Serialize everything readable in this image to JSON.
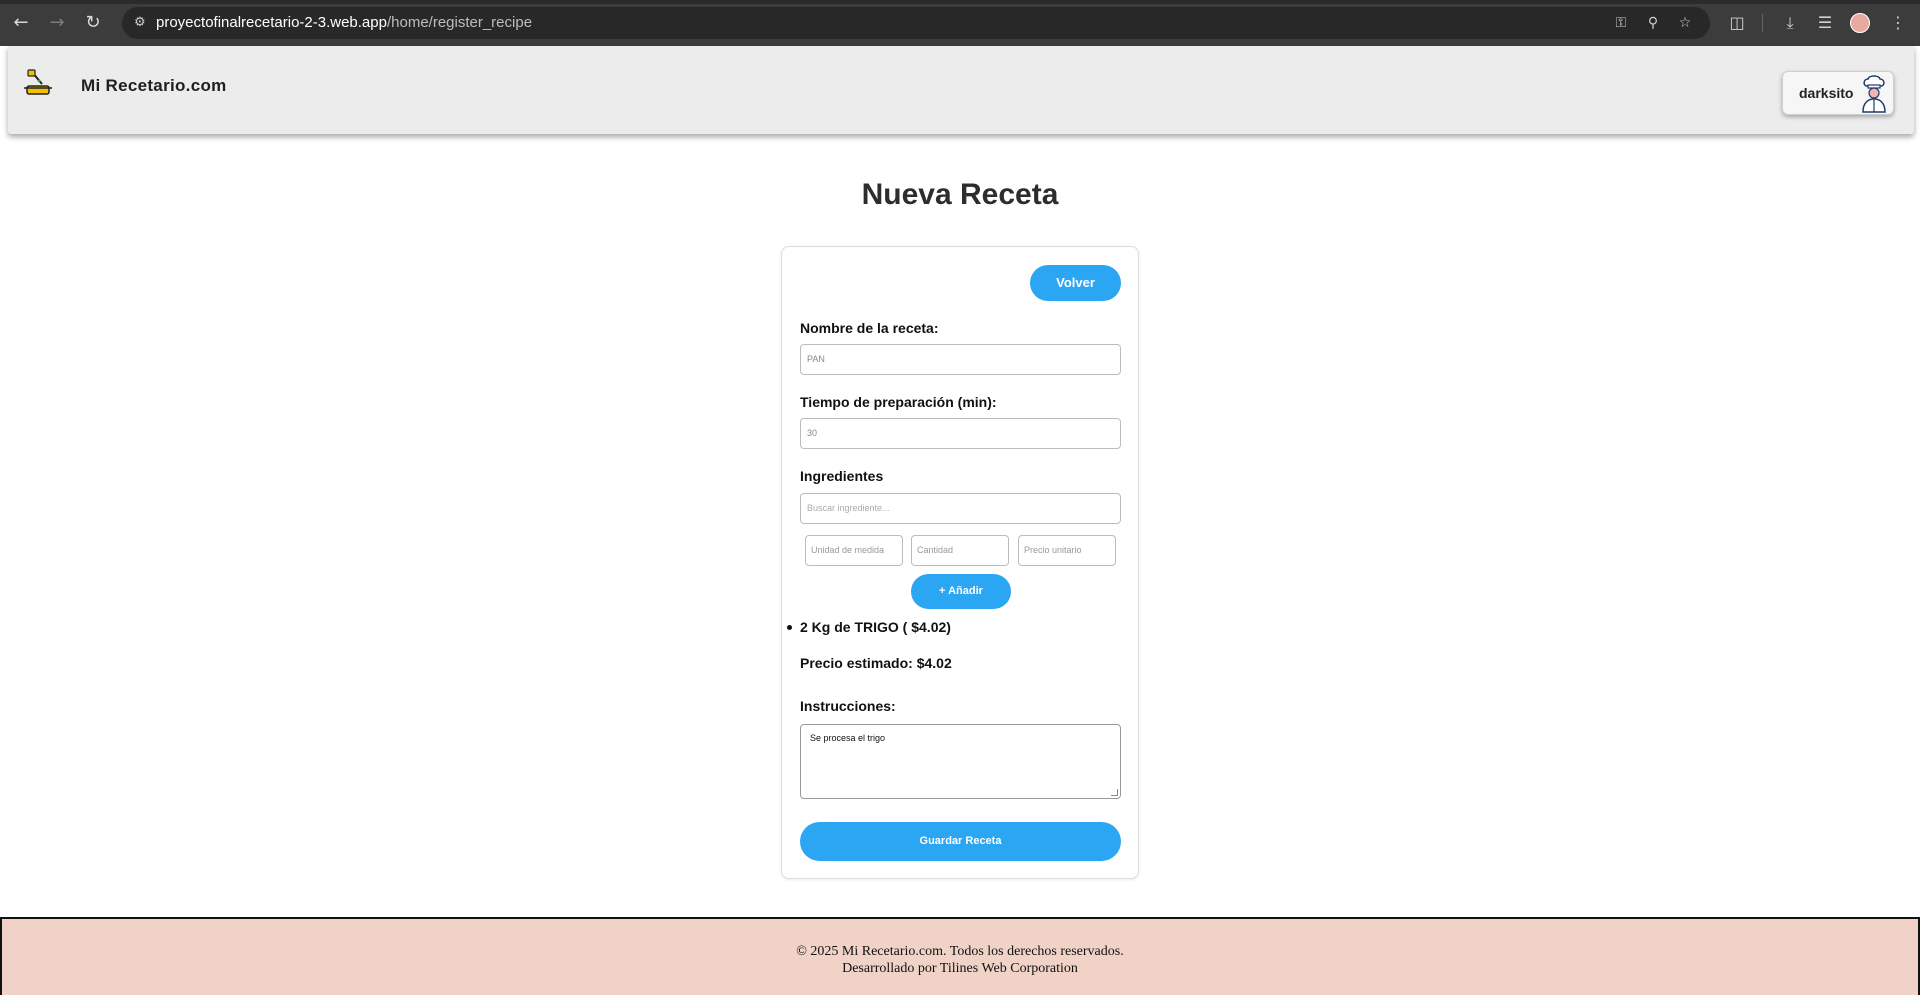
{
  "browser": {
    "url_host": "proyectofinalrecetario-2-3.web.app",
    "url_path": "/home/register_recipe",
    "icons": [
      "back-icon",
      "forward-icon",
      "reload-icon",
      "site-info-icon",
      "password-key-icon",
      "zoom-icon",
      "bookmark-star-icon",
      "extensions-icon",
      "download-icon",
      "reading-list-icon",
      "profile-avatar",
      "menu-icon"
    ]
  },
  "header": {
    "brand": "Mi Recetario.com",
    "username": "darksito"
  },
  "main": {
    "title": "Nueva Receta",
    "back_label": "Volver",
    "name_label": "Nombre de la receta:",
    "name_value": "PAN",
    "time_label": "Tiempo de preparación (min):",
    "time_value": "30",
    "ingredients_label": "Ingredientes",
    "search_placeholder": "Buscar ingrediente...",
    "unit_placeholder": "Unidad de medida",
    "quantity_placeholder": "Cantidad",
    "price_placeholder": "Precio unitario",
    "add_label": "+ Añadir",
    "ingredient_items": [
      "2 Kg de TRIGO ( $4.02)"
    ],
    "estimated_price": "Precio estimado: $4.02",
    "instructions_label": "Instrucciones:",
    "instructions_value": "Se procesa el trigo",
    "save_label": "Guardar Receta"
  },
  "footer": {
    "line1": "© 2025 Mi Recetario.com. Todos los derechos reservados.",
    "line2": "Desarrollado por Tilines Web Corporation"
  },
  "colors": {
    "accent": "#2aa6f3",
    "footer_bg": "#f0d3c6",
    "header_bg": "#ececec"
  }
}
